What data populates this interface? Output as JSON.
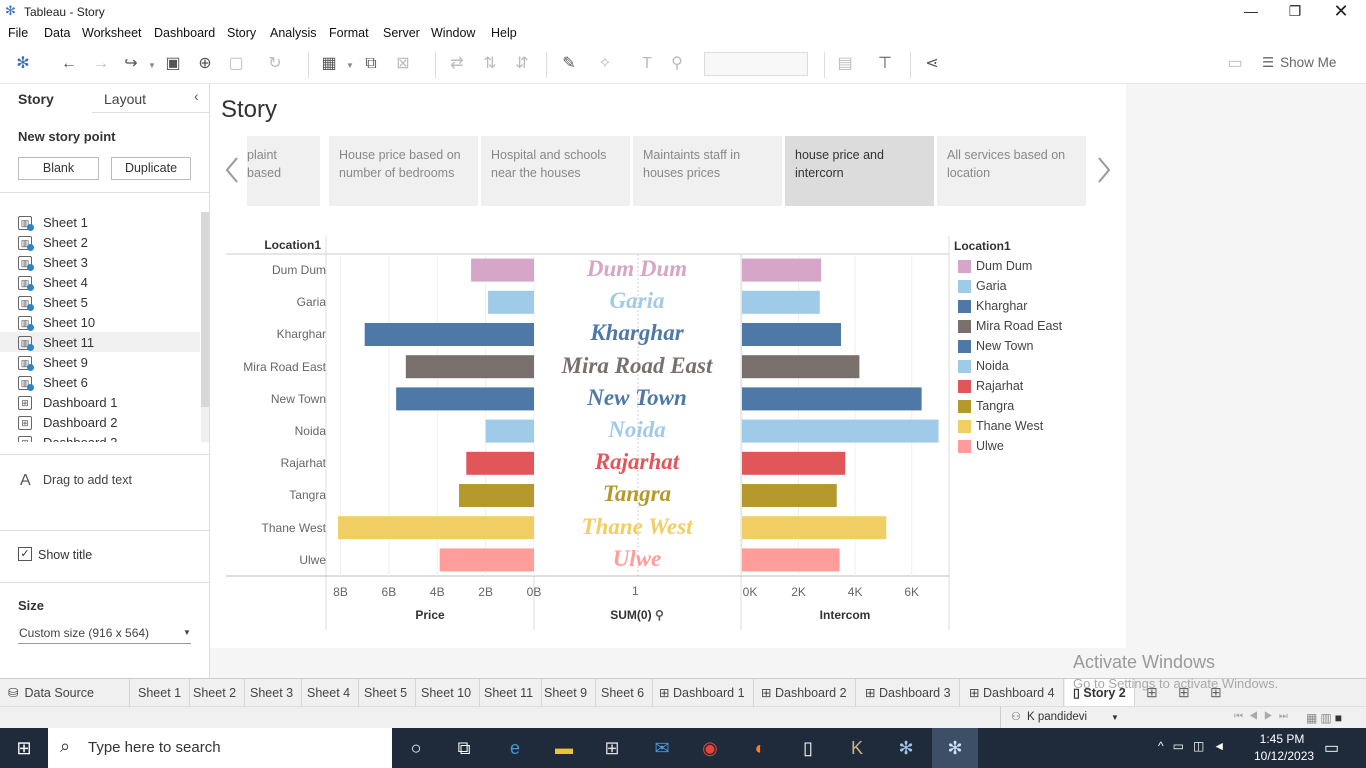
{
  "window": {
    "title": "Tableau - Story"
  },
  "menu": [
    "File",
    "Data",
    "Worksheet",
    "Dashboard",
    "Story",
    "Analysis",
    "Format",
    "Server",
    "Window",
    "Help"
  ],
  "toolbar": {
    "show_me": "Show Me"
  },
  "sidebar": {
    "tab_story": "Story",
    "tab_layout": "Layout",
    "new_story_point": "New story point",
    "blank_label": "Blank",
    "duplicate_label": "Duplicate",
    "items": [
      {
        "label": "Sheet 1",
        "type": "sheet"
      },
      {
        "label": "Sheet 2",
        "type": "sheet"
      },
      {
        "label": "Sheet 3",
        "type": "sheet"
      },
      {
        "label": "Sheet 4",
        "type": "sheet"
      },
      {
        "label": "Sheet 5",
        "type": "sheet"
      },
      {
        "label": "Sheet 10",
        "type": "sheet"
      },
      {
        "label": "Sheet 11",
        "type": "sheet"
      },
      {
        "label": "Sheet 9",
        "type": "sheet"
      },
      {
        "label": "Sheet 6",
        "type": "sheet"
      },
      {
        "label": "Dashboard 1",
        "type": "dashboard"
      },
      {
        "label": "Dashboard 2",
        "type": "dashboard"
      },
      {
        "label": "Dashboard 3",
        "type": "dashboard"
      }
    ],
    "drag_text": "Drag to add text",
    "show_title": "Show title",
    "size_header": "Size",
    "size_value": "Custom size (916 x 564)"
  },
  "story": {
    "title": "Story",
    "points": [
      {
        "label": "plaint based",
        "active": false
      },
      {
        "label": "House price based on number of bedrooms",
        "active": false
      },
      {
        "label": "Hospital and schools near the houses",
        "active": false
      },
      {
        "label": "Maintaints staff in houses prices",
        "active": false
      },
      {
        "label": "house price and intercorn",
        "active": true
      },
      {
        "label": "All services based on location",
        "active": false
      }
    ]
  },
  "chart_data": {
    "type": "bar",
    "row_header": "Location1",
    "categories": [
      "Dum Dum",
      "Garia",
      "Kharghar",
      "Mira Road East",
      "New Town",
      "Noida",
      "Rajarhat",
      "Tangra",
      "Thane West",
      "Ulwe"
    ],
    "colors": [
      "#d5a6c8",
      "#a0cbe8",
      "#4e79a7",
      "#79706e",
      "#4e79a7",
      "#a0cbe8",
      "#e15759",
      "#b6992d",
      "#f1ce63",
      "#ff9d9a"
    ],
    "series": [
      {
        "name": "Price",
        "values": [
          2.6,
          1.9,
          7.0,
          5.3,
          5.7,
          2.0,
          2.8,
          3.1,
          8.1,
          3.9
        ],
        "unit": "B",
        "reversed": true,
        "xlim": [
          0,
          8.6
        ],
        "ticks": [
          "8B",
          "6B",
          "4B",
          "2B",
          "0B"
        ],
        "tick_values": [
          8,
          6,
          4,
          2,
          0
        ]
      },
      {
        "name": "SUM(0)",
        "ticks": [
          "1"
        ]
      },
      {
        "name": "Intercom",
        "values": [
          2800,
          2750,
          3500,
          4150,
          6350,
          6950,
          3650,
          3350,
          5100,
          3450
        ],
        "unit": "K",
        "xlim": [
          0,
          7000
        ],
        "ticks": [
          "0K",
          "2K",
          "4K",
          "6K"
        ],
        "tick_values": [
          0,
          2000,
          4000,
          6000
        ]
      }
    ],
    "legend_title": "Location1",
    "legend_position": "right",
    "legend": [
      {
        "label": "Dum Dum",
        "color": "#d5a6c8"
      },
      {
        "label": "Garia",
        "color": "#a0cbe8"
      },
      {
        "label": "Kharghar",
        "color": "#4e79a7"
      },
      {
        "label": "Mira Road East",
        "color": "#79706e"
      },
      {
        "label": "New Town",
        "color": "#4e79a7"
      },
      {
        "label": "Noida",
        "color": "#a0cbe8"
      },
      {
        "label": "Rajarhat",
        "color": "#e15759"
      },
      {
        "label": "Tangra",
        "color": "#b6992d"
      },
      {
        "label": "Thane West",
        "color": "#f1ce63"
      },
      {
        "label": "Ulwe",
        "color": "#ff9d9a"
      }
    ]
  },
  "tabs": [
    "Data Source",
    "Sheet 1",
    "Sheet 2",
    "Sheet 3",
    "Sheet 4",
    "Sheet 5",
    "Sheet 10",
    "Sheet 11",
    "Sheet 9",
    "Sheet 6",
    "Dashboard 1",
    "Dashboard 2",
    "Dashboard 3",
    "Dashboard 4",
    "Story 2"
  ],
  "status": {
    "user": "K pandidevi"
  },
  "watermark": {
    "line1": "Activate Windows",
    "line2": "Go to Settings to activate Windows."
  },
  "taskbar": {
    "search_placeholder": "Type here to search",
    "time": "1:45 PM",
    "date": "10/12/2023"
  }
}
